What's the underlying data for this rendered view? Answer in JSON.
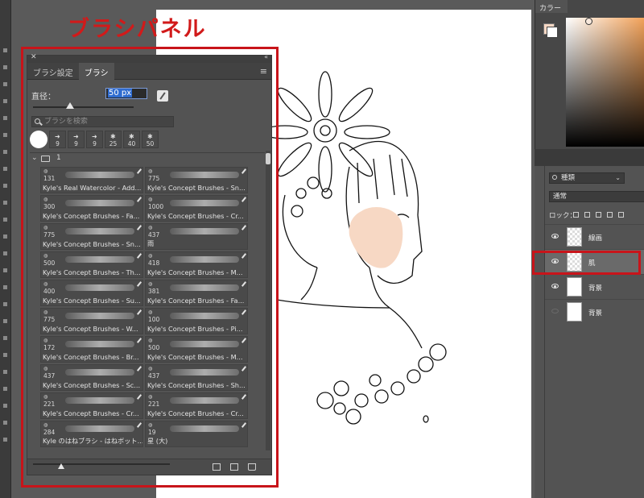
{
  "annotation": {
    "title": "ブラシパネル",
    "color": "#c8141a"
  },
  "brush_panel": {
    "tabs": [
      {
        "label": "ブラシ設定",
        "active": false
      },
      {
        "label": "ブラシ",
        "active": true
      }
    ],
    "size_label": "直径：",
    "size_value": "50 px",
    "size_fraction": 0.37,
    "search_placeholder": "ブラシを検索",
    "presets": [
      {
        "num": "50",
        "glyph": "circle"
      },
      {
        "num": "9",
        "glyph": "arrow"
      },
      {
        "num": "9",
        "glyph": "arrow"
      },
      {
        "num": "9",
        "glyph": "arrow"
      },
      {
        "num": "25",
        "glyph": "splat"
      },
      {
        "num": "40",
        "glyph": "splat"
      },
      {
        "num": "50",
        "glyph": "splat"
      }
    ],
    "group_number": "1",
    "brushes": [
      {
        "size": "131",
        "name": "Kyle's Real Watercolor - Add..."
      },
      {
        "size": "775",
        "name": "Kyle's Concept Brushes - Sn..."
      },
      {
        "size": "300",
        "name": "Kyle's Concept Brushes - Fa..."
      },
      {
        "size": "1000",
        "name": "Kyle's Concept Brushes - Cr..."
      },
      {
        "size": "775",
        "name": "Kyle's Concept Brushes - Sn..."
      },
      {
        "size": "437",
        "name": "雨"
      },
      {
        "size": "500",
        "name": "Kyle's Concept Brushes - Th..."
      },
      {
        "size": "418",
        "name": "Kyle's Concept Brushes - M..."
      },
      {
        "size": "400",
        "name": "Kyle's Concept Brushes - Su..."
      },
      {
        "size": "381",
        "name": "Kyle's Concept Brushes - Fa..."
      },
      {
        "size": "775",
        "name": "Kyle's Concept Brushes - W..."
      },
      {
        "size": "100",
        "name": "Kyle's Concept Brushes - Pi..."
      },
      {
        "size": "172",
        "name": "Kyle's Concept Brushes - Br..."
      },
      {
        "size": "500",
        "name": "Kyle's Concept Brushes - M..."
      },
      {
        "size": "437",
        "name": "Kyle's Concept Brushes - Sc..."
      },
      {
        "size": "437",
        "name": "Kyle's Concept Brushes - Sh..."
      },
      {
        "size": "221",
        "name": "Kyle's Concept Brushes - Cr..."
      },
      {
        "size": "221",
        "name": "Kyle's Concept Brushes - Cr..."
      },
      {
        "size": "284",
        "name": "Kyle のはねブラシ - はねボット..."
      },
      {
        "size": "19",
        "name": "星 (大)"
      }
    ]
  },
  "color_panel": {
    "tab": "カラー",
    "background_swatch": "#f7d8c4",
    "foreground_swatch": "#ffffff"
  },
  "layers_panel": {
    "filter_label": "種類",
    "blend_mode": "通常",
    "lock_label": "ロック：",
    "layers": [
      {
        "name": "線画",
        "visible": true,
        "selected": false,
        "thumb": "checker"
      },
      {
        "name": "肌",
        "visible": true,
        "selected": true,
        "thumb": "checker"
      },
      {
        "name": "背景",
        "visible": true,
        "selected": false,
        "thumb": "white"
      },
      {
        "name": "背景",
        "visible": false,
        "selected": false,
        "thumb": "sketch"
      }
    ]
  }
}
